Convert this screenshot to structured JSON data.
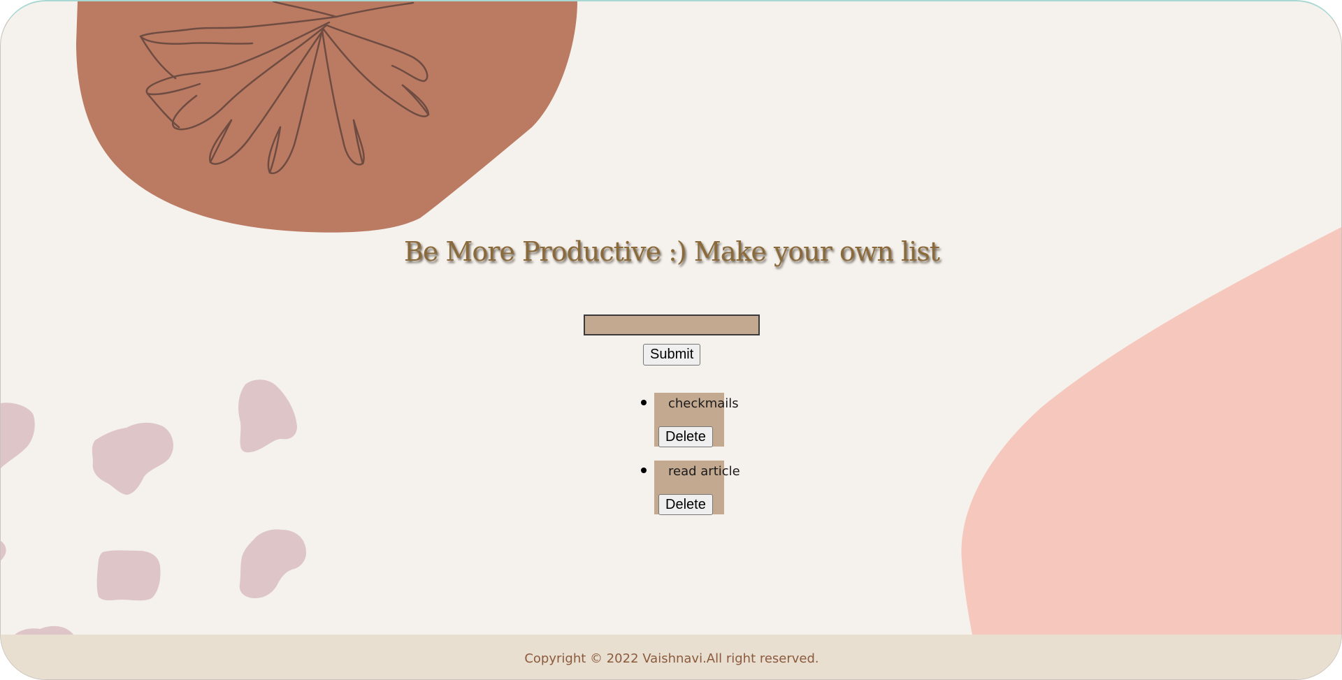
{
  "page": {
    "title": "Be More Productive :) Make your own list"
  },
  "form": {
    "input_value": "",
    "submit_label": "Submit"
  },
  "todos": [
    {
      "text": "checkmails",
      "delete_label": "Delete"
    },
    {
      "text": "read article",
      "delete_label": "Delete"
    }
  ],
  "footer": {
    "copyright": "Copyright © 2022 Vaishnavi.All right reserved."
  },
  "colors": {
    "background": "#f5f1ec",
    "terracotta_blob": "#bb7a62",
    "pink_blob": "#f6c8bd",
    "input_and_item_bg": "#c4a991",
    "title": "#8a6a3a",
    "footer_bg": "#e8dfd1",
    "footer_text": "#8b5a3c"
  }
}
